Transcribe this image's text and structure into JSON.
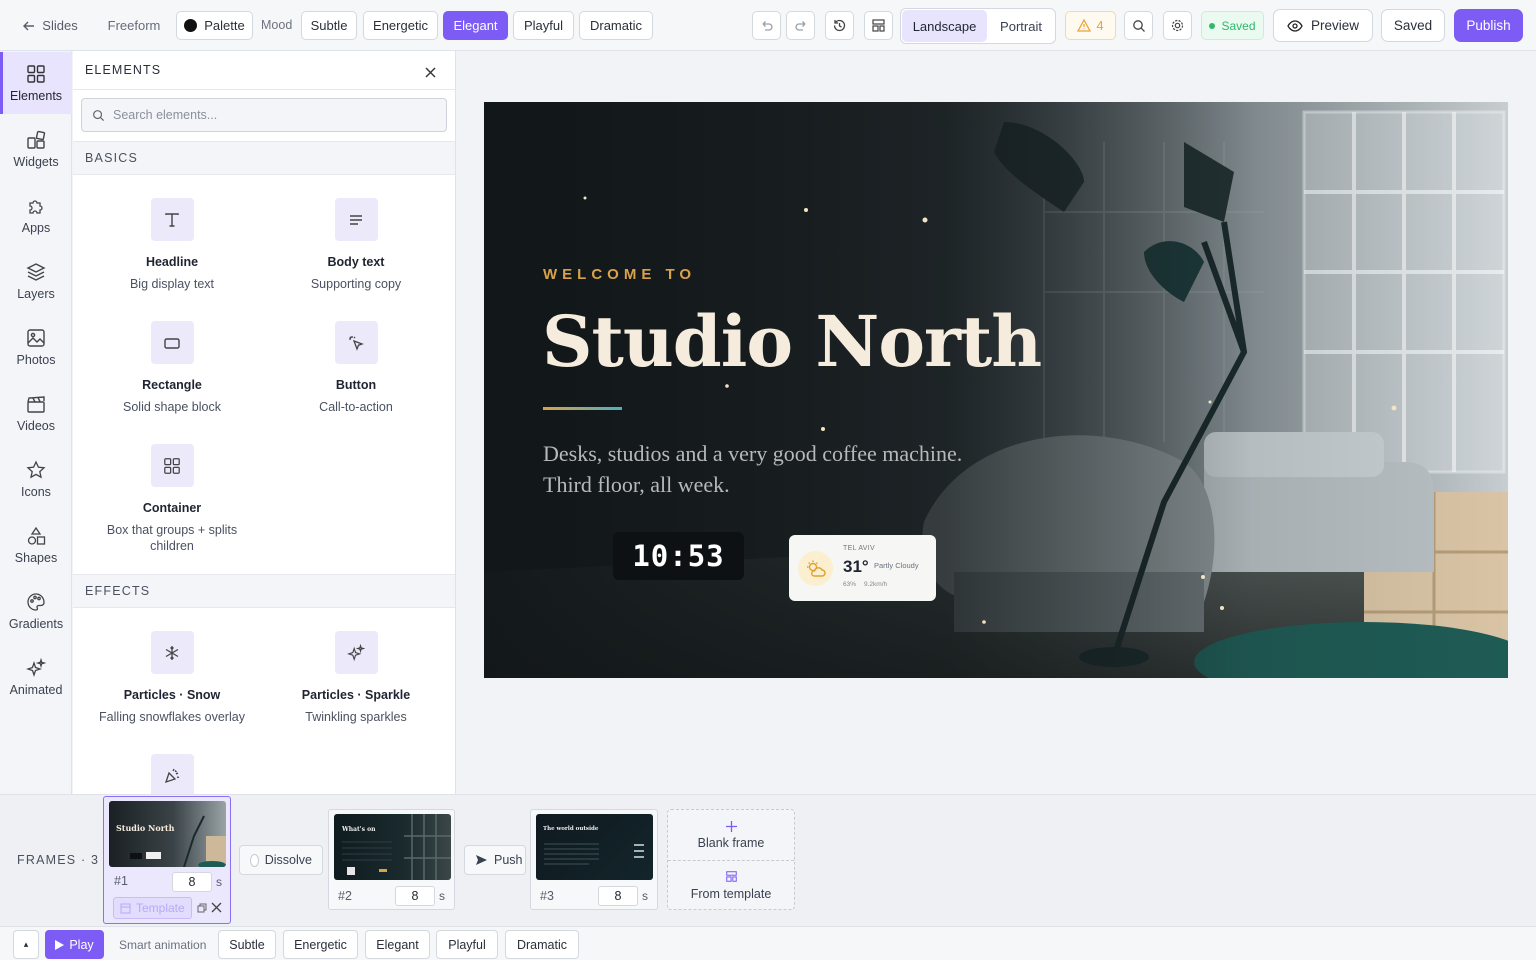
{
  "topbar": {
    "back_label": "Slides",
    "freeform_label": "Freeform",
    "palette_label": "Palette",
    "mood_label": "Mood",
    "moods": [
      "Subtle",
      "Energetic",
      "Elegant",
      "Playful",
      "Dramatic"
    ],
    "active_mood": "Elegant",
    "orientation": [
      "Landscape",
      "Portrait"
    ],
    "warnings_count": "4",
    "status": "Saved",
    "preview_label": "Preview",
    "saved_label": "Saved",
    "publish_label": "Publish"
  },
  "rail": {
    "items": [
      {
        "label": "Elements",
        "icon": "grid-icon"
      },
      {
        "label": "Widgets",
        "icon": "widgets-icon"
      },
      {
        "label": "Apps",
        "icon": "puzzle-icon"
      },
      {
        "label": "Layers",
        "icon": "layers-icon"
      },
      {
        "label": "Photos",
        "icon": "image-icon"
      },
      {
        "label": "Videos",
        "icon": "clapper-icon"
      },
      {
        "label": "Icons",
        "icon": "star-icon"
      },
      {
        "label": "Shapes",
        "icon": "shapes-icon"
      },
      {
        "label": "Gradients",
        "icon": "palette-icon"
      },
      {
        "label": "Animated",
        "icon": "sparkles-icon"
      }
    ]
  },
  "panel": {
    "title": "ELEMENTS",
    "search_placeholder": "Search elements...",
    "basics_header": "BASICS",
    "effects_header": "EFFECTS",
    "basics": [
      {
        "name": "Headline",
        "desc": "Big display text"
      },
      {
        "name": "Body text",
        "desc": "Supporting copy"
      },
      {
        "name": "Rectangle",
        "desc": "Solid shape block"
      },
      {
        "name": "Button",
        "desc": "Call-to-action"
      },
      {
        "name": "Container",
        "desc": "Box that groups + splits children"
      }
    ],
    "effects": [
      {
        "name": "Particles · Snow",
        "desc": "Falling snowflakes overlay"
      },
      {
        "name": "Particles · Sparkle",
        "desc": "Twinkling sparkles"
      }
    ]
  },
  "slide": {
    "eyebrow": "WELCOME TO",
    "title": "Studio North",
    "body_line1": "Desks, studios and a very good coffee machine.",
    "body_line2": "Third floor, all week.",
    "clock": "10:53",
    "weather": {
      "city": "TEL AVIV",
      "temp": "31°",
      "condition": "Partly Cloudy",
      "humidity": "63%",
      "wind": "9.2km/h"
    }
  },
  "frames": {
    "label": "FRAMES · 3",
    "items": [
      {
        "number": "#1",
        "duration": "8",
        "unit": "s",
        "thumb_title": "Studio North",
        "template_label": "Template"
      },
      {
        "number": "#2",
        "duration": "8",
        "unit": "s",
        "thumb_title": "What's on"
      },
      {
        "number": "#3",
        "duration": "8",
        "unit": "s",
        "thumb_title": "The world outside"
      }
    ],
    "transitions": [
      "Dissolve",
      "Push"
    ],
    "blank_frame_label": "Blank frame",
    "from_template_label": "From template"
  },
  "bottombar": {
    "collapse_label": "▴",
    "play_label": "Play",
    "smart_animation_label": "Smart animation",
    "moods": [
      "Subtle",
      "Energetic",
      "Elegant",
      "Playful",
      "Dramatic"
    ]
  },
  "colors": {
    "accent": "#7c5cf5",
    "gold": "#d9a24a",
    "saved_green": "#2fb86a",
    "warning": "#e8a33a"
  }
}
